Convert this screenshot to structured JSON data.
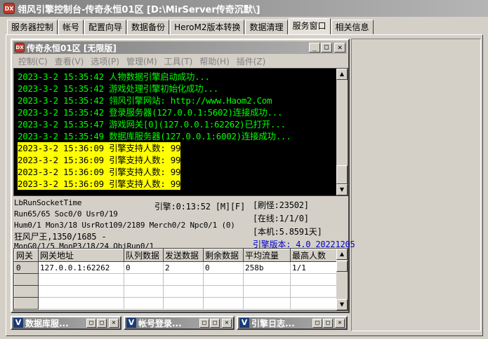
{
  "window": {
    "icon_label": "DX",
    "title": "翎风引擎控制台-传奇永恒01区 [D:\\MirServer传奇沉默\\]"
  },
  "tabs": [
    "服务器控制",
    "帐号",
    "配置向导",
    "数据备份",
    "HeroM2版本转换",
    "数据清理",
    "服务窗口",
    "相关信息"
  ],
  "active_tab": "服务窗口",
  "child": {
    "icon_label": "DX",
    "title": "传奇永恒01区 [无限版]",
    "buttons": {
      "minimize": "_",
      "restore": "□",
      "close": "✕"
    },
    "menu": [
      "控制(C)",
      "查看(V)",
      "选项(P)",
      "管理(M)",
      "工具(T)",
      "帮助(H)",
      "插件(Z)"
    ]
  },
  "log": [
    {
      "time": "2023-3-2 15:35:42",
      "msg": "人物数据引擎启动成功...",
      "highlight": false
    },
    {
      "time": "2023-3-2 15:35:42",
      "msg": "游戏处理引擎初始化成功...",
      "highlight": false
    },
    {
      "time": "2023-3-2 15:35:42",
      "msg": "翎风引擎网站: http://www.Haom2.Com",
      "highlight": false
    },
    {
      "time": "2023-3-2 15:35:42",
      "msg": "登录服务器(127.0.0.1:5602)连接成功...",
      "highlight": false
    },
    {
      "time": "2023-3-2 15:35:47",
      "msg": "游戏网关[0](127.0.0.1:62262)已打开...",
      "highlight": false
    },
    {
      "time": "2023-3-2 15:35:49",
      "msg": "数据库服务器(127.0.0.1:6002)连接成功...",
      "highlight": false
    },
    {
      "time": "2023-3-2 15:36:09",
      "msg": "引擎支持人数: 99",
      "highlight": true
    },
    {
      "time": "2023-3-2 15:36:09",
      "msg": "引擎支持人数: 99",
      "highlight": true
    },
    {
      "time": "2023-3-2 15:36:09",
      "msg": "引擎支持人数: 99",
      "highlight": true
    },
    {
      "time": "2023-3-2 15:36:09",
      "msg": "引擎支持人数: 99",
      "highlight": true
    }
  ],
  "status": {
    "socket": "LbRunSocketTime",
    "run": "Run65/65 Soc0/0 Usr0/19",
    "hum": "Hum0/1 Mon3/18 UsrRot109/2189 Merch0/2 Npc0/1 (0)",
    "monster": "狂风尸王,1350/1685 -",
    "mon": "MonG0/1/5 MonP3/18/24 ObjRun0/1",
    "engine_time": "引擎:0:13:52 [M][F]",
    "refresh": "[刷怪:23502]",
    "online": "[在线:1/1/0]",
    "local": "[本机:5.8591天]",
    "version": "引擎版本: 4.0 20221205"
  },
  "grid": {
    "columns": [
      "网关",
      "网关地址",
      "队列数据",
      "发送数据",
      "剩余数据",
      "平均流量",
      "最高人数"
    ],
    "rows": [
      [
        "0",
        "127.0.0.1:62262",
        "0",
        "2",
        "0",
        "258b",
        "1/1"
      ]
    ]
  },
  "minimized": [
    {
      "icon": "V",
      "title": "数据库服..."
    },
    {
      "icon": "V",
      "title": "帐号登录..."
    },
    {
      "icon": "V",
      "title": "引擎日志..."
    }
  ]
}
